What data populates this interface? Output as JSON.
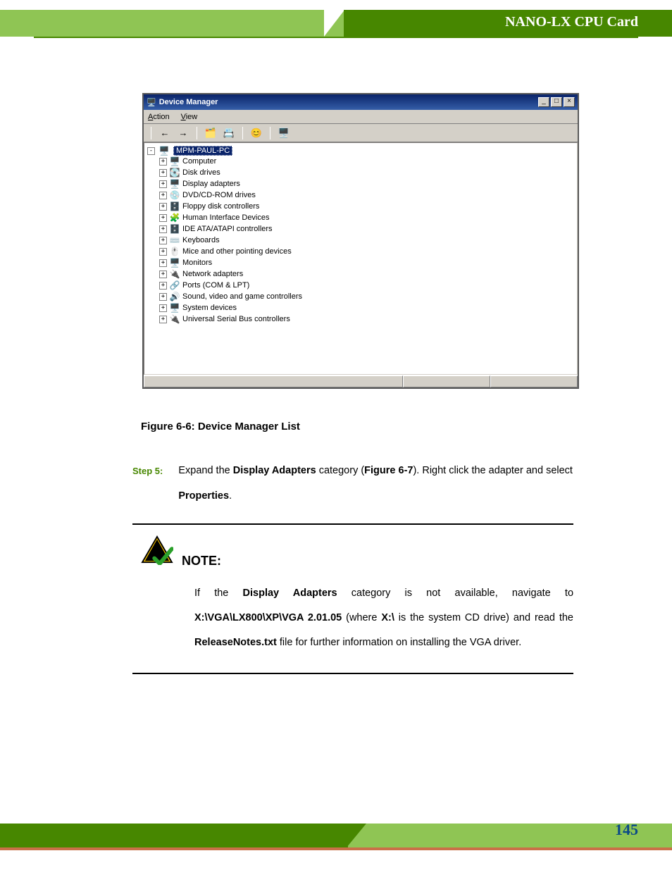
{
  "header": {
    "title": "NANO-LX CPU Card"
  },
  "devmgr": {
    "window_title": "Device Manager",
    "menu": {
      "action": "Action",
      "view": "View"
    },
    "root": "MPM-PAUL-PC",
    "nodes": [
      {
        "icon": "🖥️",
        "label": "Computer"
      },
      {
        "icon": "💽",
        "label": "Disk drives"
      },
      {
        "icon": "🖥️",
        "label": "Display adapters"
      },
      {
        "icon": "💿",
        "label": "DVD/CD-ROM drives"
      },
      {
        "icon": "🗄️",
        "label": "Floppy disk controllers"
      },
      {
        "icon": "🧩",
        "label": "Human Interface Devices"
      },
      {
        "icon": "🗄️",
        "label": "IDE ATA/ATAPI controllers"
      },
      {
        "icon": "⌨️",
        "label": "Keyboards"
      },
      {
        "icon": "🖱️",
        "label": "Mice and other pointing devices"
      },
      {
        "icon": "🖥️",
        "label": "Monitors"
      },
      {
        "icon": "🔌",
        "label": "Network adapters"
      },
      {
        "icon": "🔗",
        "label": "Ports (COM & LPT)"
      },
      {
        "icon": "🔊",
        "label": "Sound, video and game controllers"
      },
      {
        "icon": "🖥️",
        "label": "System devices"
      },
      {
        "icon": "🔌",
        "label": "Universal Serial Bus controllers"
      }
    ]
  },
  "caption": "Figure 6-6: Device Manager List",
  "step": {
    "label": "Step 5:",
    "body_part1": "Expand the ",
    "bold1": "Display Adapters",
    "body_part2": " category (",
    "bold2": "Figure 6-7",
    "body_part3": "). Right click the adapter and select ",
    "bold3": "Properties",
    "body_part4": "."
  },
  "note": {
    "title": "NOTE:",
    "p1": "If the ",
    "b1": "Display Adapters",
    "p2": " category is not available, navigate to ",
    "b2": "X:\\VGA\\LX800\\XP\\VGA 2.01.05",
    "p3": " (where ",
    "b3": "X:\\",
    "p4": " is the system CD drive) and read the ",
    "b4": "ReleaseNotes.txt",
    "p5": " file for further information on installing the VGA driver."
  },
  "page_number": "145"
}
